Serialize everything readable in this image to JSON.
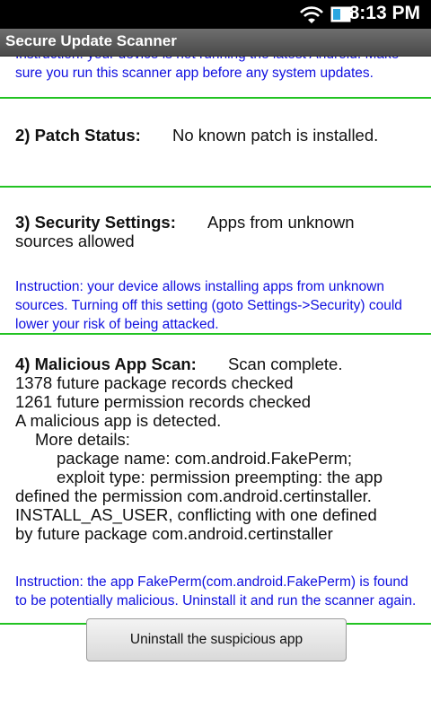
{
  "status_bar": {
    "time": "8:13 PM",
    "wifi_icon": "wifi-icon",
    "battery_icon": "battery-icon"
  },
  "title_bar": {
    "title": "Secure Update Scanner"
  },
  "section1": {
    "instruction_partial": "Instruction: your device is not running the latest Android. Make sure you run this scanner app before any system updates."
  },
  "section2": {
    "heading": "2) Patch Status:",
    "value": "No known patch is installed."
  },
  "section3": {
    "heading": "3) Security Settings:",
    "value_line1": "Apps from unknown",
    "value_line2": "sources allowed",
    "instruction": "Instruction: your device allows installing apps from unknown sources. Turning off this setting (goto Settings->Security) could lower your risk of being attacked."
  },
  "section4": {
    "heading": "4) Malicious App Scan:",
    "value": "Scan complete.",
    "line1": "1378 future package records checked",
    "line2": "1261 future permission records checked",
    "line3": "A malicious app is detected.",
    "more_details": "More details:",
    "package_name": "package name: com.android.FakePerm;",
    "exploit_type_first": "exploit type: permission preempting: the app",
    "exploit_line2": "defined the permission com.android.certinstaller.",
    "exploit_line3": "INSTALL_AS_USER, conflicting with one defined",
    "exploit_line4": "by future package com.android.certinstaller",
    "instruction": "Instruction: the app FakePerm(com.android.FakePerm) is found to be potentially malicious. Uninstall it and run the scanner again."
  },
  "action": {
    "button_label": "Uninstall the suspicious app"
  },
  "colors": {
    "instruction_text": "#1010e0",
    "divider": "#22c322",
    "title_bar": "#5a5a5a"
  }
}
